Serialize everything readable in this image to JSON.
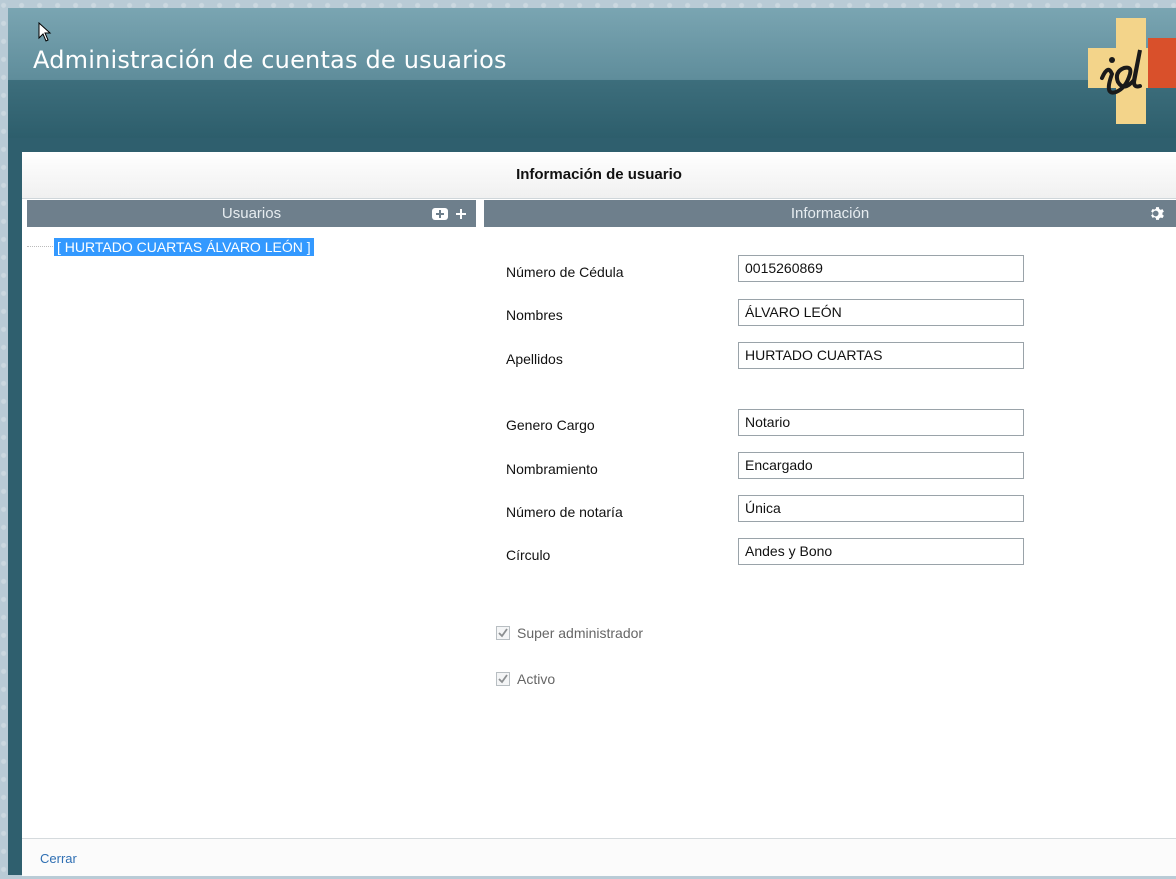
{
  "window": {
    "title": "Administración de cuentas de usuarios"
  },
  "dialog": {
    "header": "Información de usuario",
    "close_label": "Cerrar"
  },
  "users_panel": {
    "title": "Usuarios",
    "icons": [
      "add-user-icon",
      "plus-icon"
    ],
    "items": [
      {
        "label": "[ HURTADO CUARTAS ÁLVARO LEÓN ]",
        "selected": true
      }
    ]
  },
  "info_panel": {
    "title": "Información",
    "settings_icon": "gear-icon",
    "fields": [
      {
        "label": "Número de Cédula",
        "value": "0015260869"
      },
      {
        "label": "Nombres",
        "value": "ÁLVARO LEÓN"
      },
      {
        "label": "Apellidos",
        "value": "HURTADO CUARTAS"
      },
      {
        "label": "Genero Cargo",
        "value": "Notario"
      },
      {
        "label": "Nombramiento",
        "value": "Encargado"
      },
      {
        "label": "Número de notaría",
        "value": "Única"
      },
      {
        "label": "Círculo",
        "value": "Andes y Bono"
      }
    ],
    "checkboxes": [
      {
        "label": "Super administrador",
        "checked": true,
        "disabled": true
      },
      {
        "label": "Activo",
        "checked": true,
        "disabled": true
      }
    ]
  },
  "colors": {
    "titlebar": "#5f8d9b",
    "panel_bar": "#6e7f8c",
    "selection": "#3399ff",
    "link": "#2f6fb3"
  }
}
